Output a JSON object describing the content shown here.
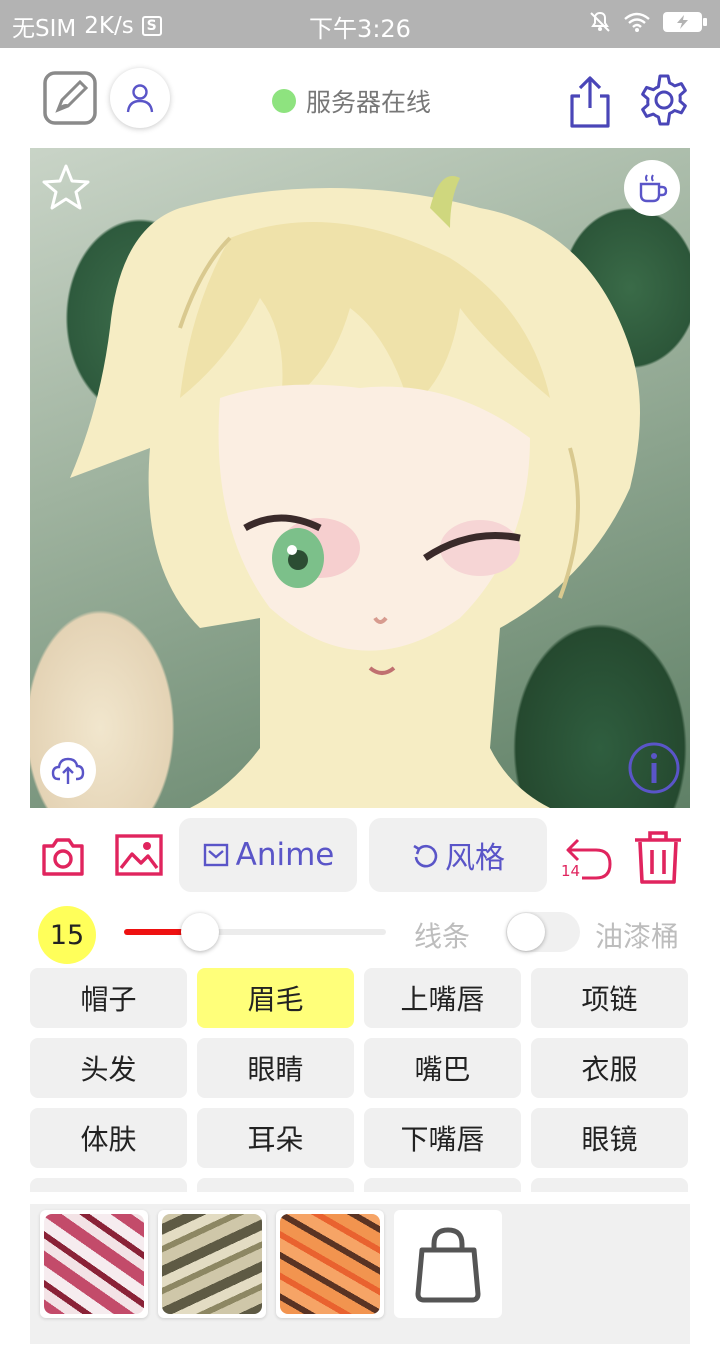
{
  "status_bar": {
    "carrier": "无SIM",
    "speed": "2K/s",
    "s_icon_text": "S",
    "time": "下午3:26",
    "icons": [
      "mute-icon",
      "wifi-icon",
      "battery-charging-icon"
    ]
  },
  "header": {
    "server_status": "服务器在线",
    "server_status_color": "#8ee37f",
    "icons": [
      "canvas-edit-icon",
      "user-icon",
      "share-icon",
      "settings-icon"
    ]
  },
  "artwork": {
    "overlay_icons": [
      "star-icon",
      "coffee-icon",
      "cloud-upload-icon",
      "info-icon"
    ]
  },
  "toolbar": {
    "anime_label": "Anime",
    "style_label": "风格",
    "undo_count": "14",
    "icons": [
      "camera-icon",
      "gallery-icon",
      "mail-icon",
      "refresh-icon",
      "undo-icon",
      "trash-icon"
    ]
  },
  "brush": {
    "size": "15",
    "slider_fraction": 0.29,
    "line_label": "线条",
    "bucket_label": "油漆桶",
    "bucket_on": false
  },
  "parts": [
    {
      "label": "帽子",
      "active": false
    },
    {
      "label": "眉毛",
      "active": true
    },
    {
      "label": "上嘴唇",
      "active": false
    },
    {
      "label": "项链",
      "active": false
    },
    {
      "label": "头发",
      "active": false
    },
    {
      "label": "眼睛",
      "active": false
    },
    {
      "label": "嘴巴",
      "active": false
    },
    {
      "label": "衣服",
      "active": false
    },
    {
      "label": "体肤",
      "active": false
    },
    {
      "label": "耳朵",
      "active": false
    },
    {
      "label": "下嘴唇",
      "active": false
    },
    {
      "label": "眼镜",
      "active": false
    },
    {
      "label": "",
      "active": false
    },
    {
      "label": "",
      "active": false
    },
    {
      "label": "",
      "active": false
    },
    {
      "label": "",
      "active": false
    }
  ],
  "colors": {
    "accent_purple": "#5a55c8",
    "accent_pink": "#e0245e",
    "active_yellow": "#ffff7a",
    "slider_red": "#ee1111"
  }
}
